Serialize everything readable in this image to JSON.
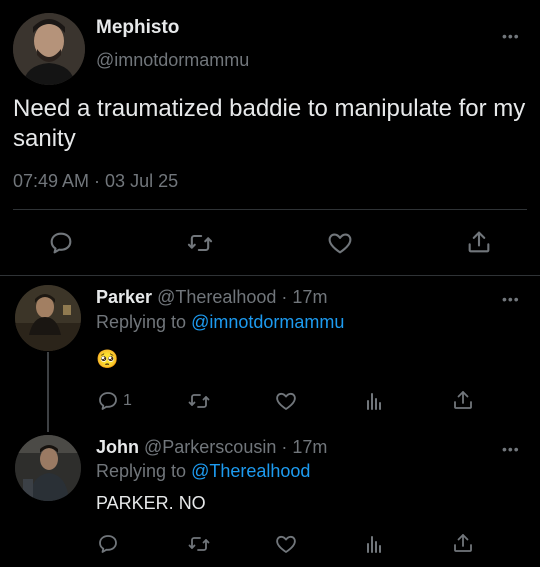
{
  "main_tweet": {
    "display_name": "Mephisto",
    "handle": "@imnotdormammu",
    "text": "Need a traumatized baddie to manipulate for my sanity",
    "timestamp": "07:49 AM · 03 Jul 25",
    "more_label": "•••"
  },
  "replies": [
    {
      "display_name": "Parker",
      "handle": "@Therealhood · 17m",
      "replying_prefix": "Replying to",
      "replying_handle": "@imnotdormammu",
      "text": "🥺",
      "reply_count": "1",
      "more_label": "•••"
    },
    {
      "display_name": "John",
      "handle": "@Parkerscousin · 17m",
      "replying_prefix": "Replying to",
      "replying_handle": "@Therealhood",
      "text": "PARKER. NO",
      "reply_count": "",
      "more_label": "•••"
    }
  ],
  "colors": {
    "background": "#000000",
    "text": "#e7e9ea",
    "muted": "#71767b",
    "link": "#1d9bf0",
    "divider": "#2f3336"
  },
  "icons": [
    "reply-icon",
    "retweet-icon",
    "like-icon",
    "share-icon",
    "analytics-icon",
    "more-icon"
  ]
}
